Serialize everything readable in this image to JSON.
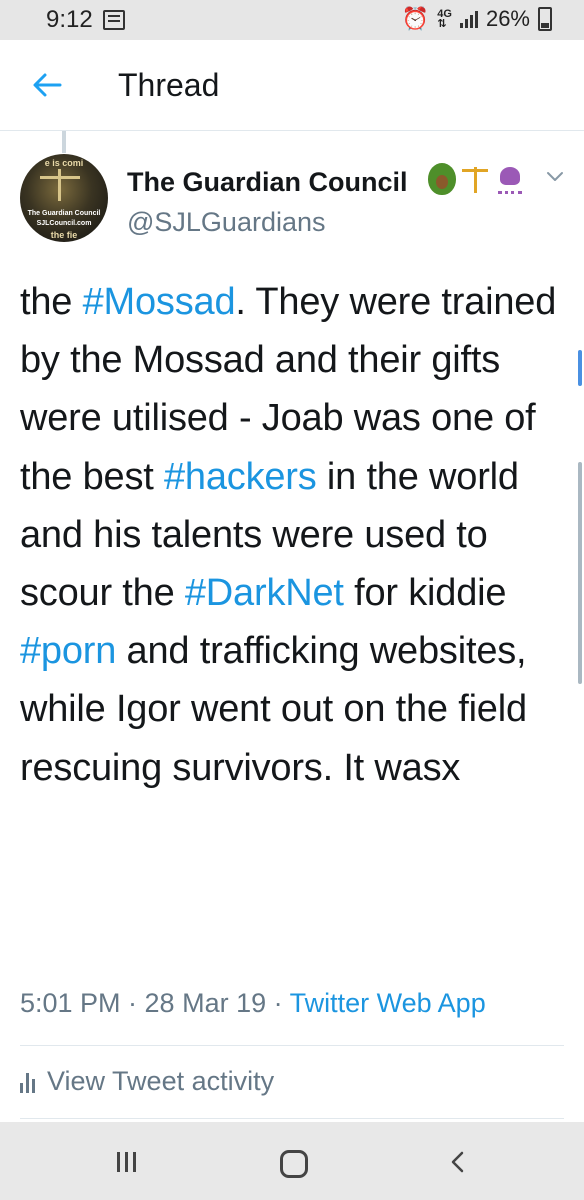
{
  "status_bar": {
    "time": "9:12",
    "data_label_top": "4G",
    "battery": "26%",
    "icons": [
      "message-icon",
      "alarm-icon",
      "data-arrows-icon",
      "signal-icon",
      "battery-icon"
    ]
  },
  "header": {
    "title": "Thread",
    "back_icon": "arrow-left-icon"
  },
  "tweet": {
    "display_name": "The Guardian Council",
    "name_emojis": [
      "avocado-icon",
      "scales-icon",
      "octopus-icon"
    ],
    "handle": "@SJLGuardians",
    "avatar_text_top": "e is comi",
    "avatar_text_org": "The Guardian Council",
    "avatar_text_site": "SJLCouncil.com",
    "avatar_text_bottom": "the fie",
    "text_segments": [
      {
        "t": "the ",
        "tag": false
      },
      {
        "t": "#Mossad",
        "tag": true
      },
      {
        "t": ". They were trained by the Mossad and their gifts were utilised - Joab was one of the best ",
        "tag": false
      },
      {
        "t": "#hackers",
        "tag": true
      },
      {
        "t": " in the world and his talents were used to scour the ",
        "tag": false
      },
      {
        "t": "#DarkNet",
        "tag": true
      },
      {
        "t": " for kiddie ",
        "tag": false
      },
      {
        "t": "#porn",
        "tag": true
      },
      {
        "t": " and trafficking websites, while Igor went out on the field rescuing survivors. It wasx",
        "tag": false
      }
    ],
    "timestamp": "5:01 PM · 28 Mar 19 · ",
    "source_app": "Twitter Web App",
    "activity_label": "View Tweet activity"
  },
  "colors": {
    "link": "#1b95e0",
    "text": "#14171a",
    "secondary": "#657786"
  },
  "nav": {
    "icons": [
      "recent-apps-icon",
      "home-icon",
      "back-icon"
    ]
  }
}
